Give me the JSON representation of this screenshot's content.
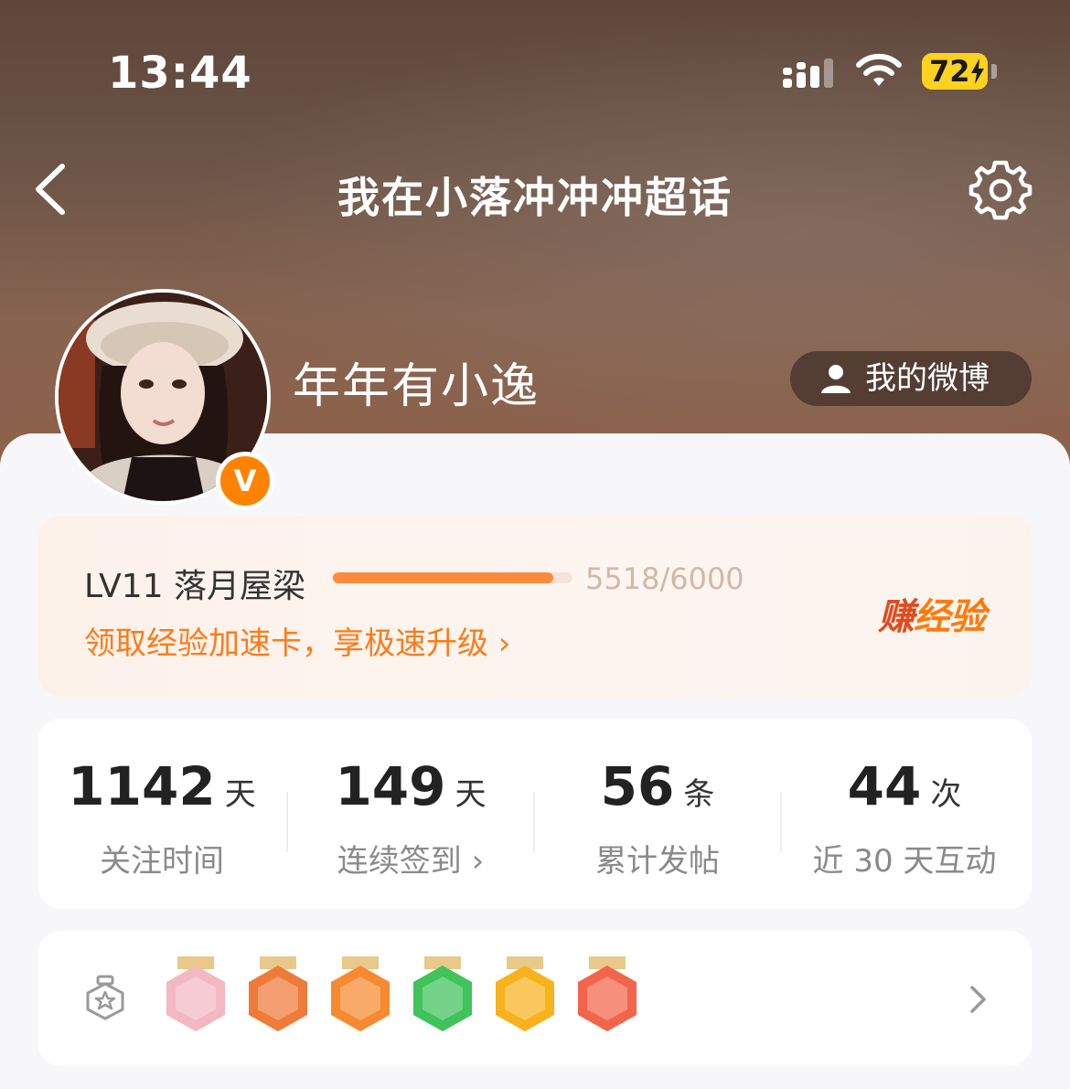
{
  "status_bar": {
    "time": "13:44",
    "battery": "72"
  },
  "header": {
    "title": "我在小落冲冲冲超话"
  },
  "profile": {
    "name": "年年有小逸",
    "verified_badge": "V",
    "my_weibo_label": "我的微博"
  },
  "level": {
    "label": "LV11 落月屋梁",
    "current": "5518/6000",
    "progress": 0.92,
    "promo": "领取经验加速卡，享极速升级 ›",
    "earn_left": "赚",
    "earn_right": "经验"
  },
  "stats": [
    {
      "value": "1142",
      "unit": "天",
      "label": "关注时间"
    },
    {
      "value": "149",
      "unit": "天",
      "label": "连续签到 ›"
    },
    {
      "value": "56",
      "unit": "条",
      "label": "累计发帖"
    },
    {
      "value": "44",
      "unit": "次",
      "label": "近 30 天互动"
    }
  ],
  "badges": [
    {
      "name": "avatar-badge",
      "color": "#f3b8c2"
    },
    {
      "name": "100-days-badge",
      "color": "#f07a3a"
    },
    {
      "name": "lv11-badge",
      "color": "#f58a30"
    },
    {
      "name": "hand-badge",
      "color": "#3fc35a"
    },
    {
      "name": "30-days-badge",
      "color": "#f7b21d"
    },
    {
      "name": "rock-hand-badge",
      "color": "#f3654a"
    }
  ],
  "colors": {
    "accent": "#ff7a1a",
    "brand": "#ff8200"
  }
}
